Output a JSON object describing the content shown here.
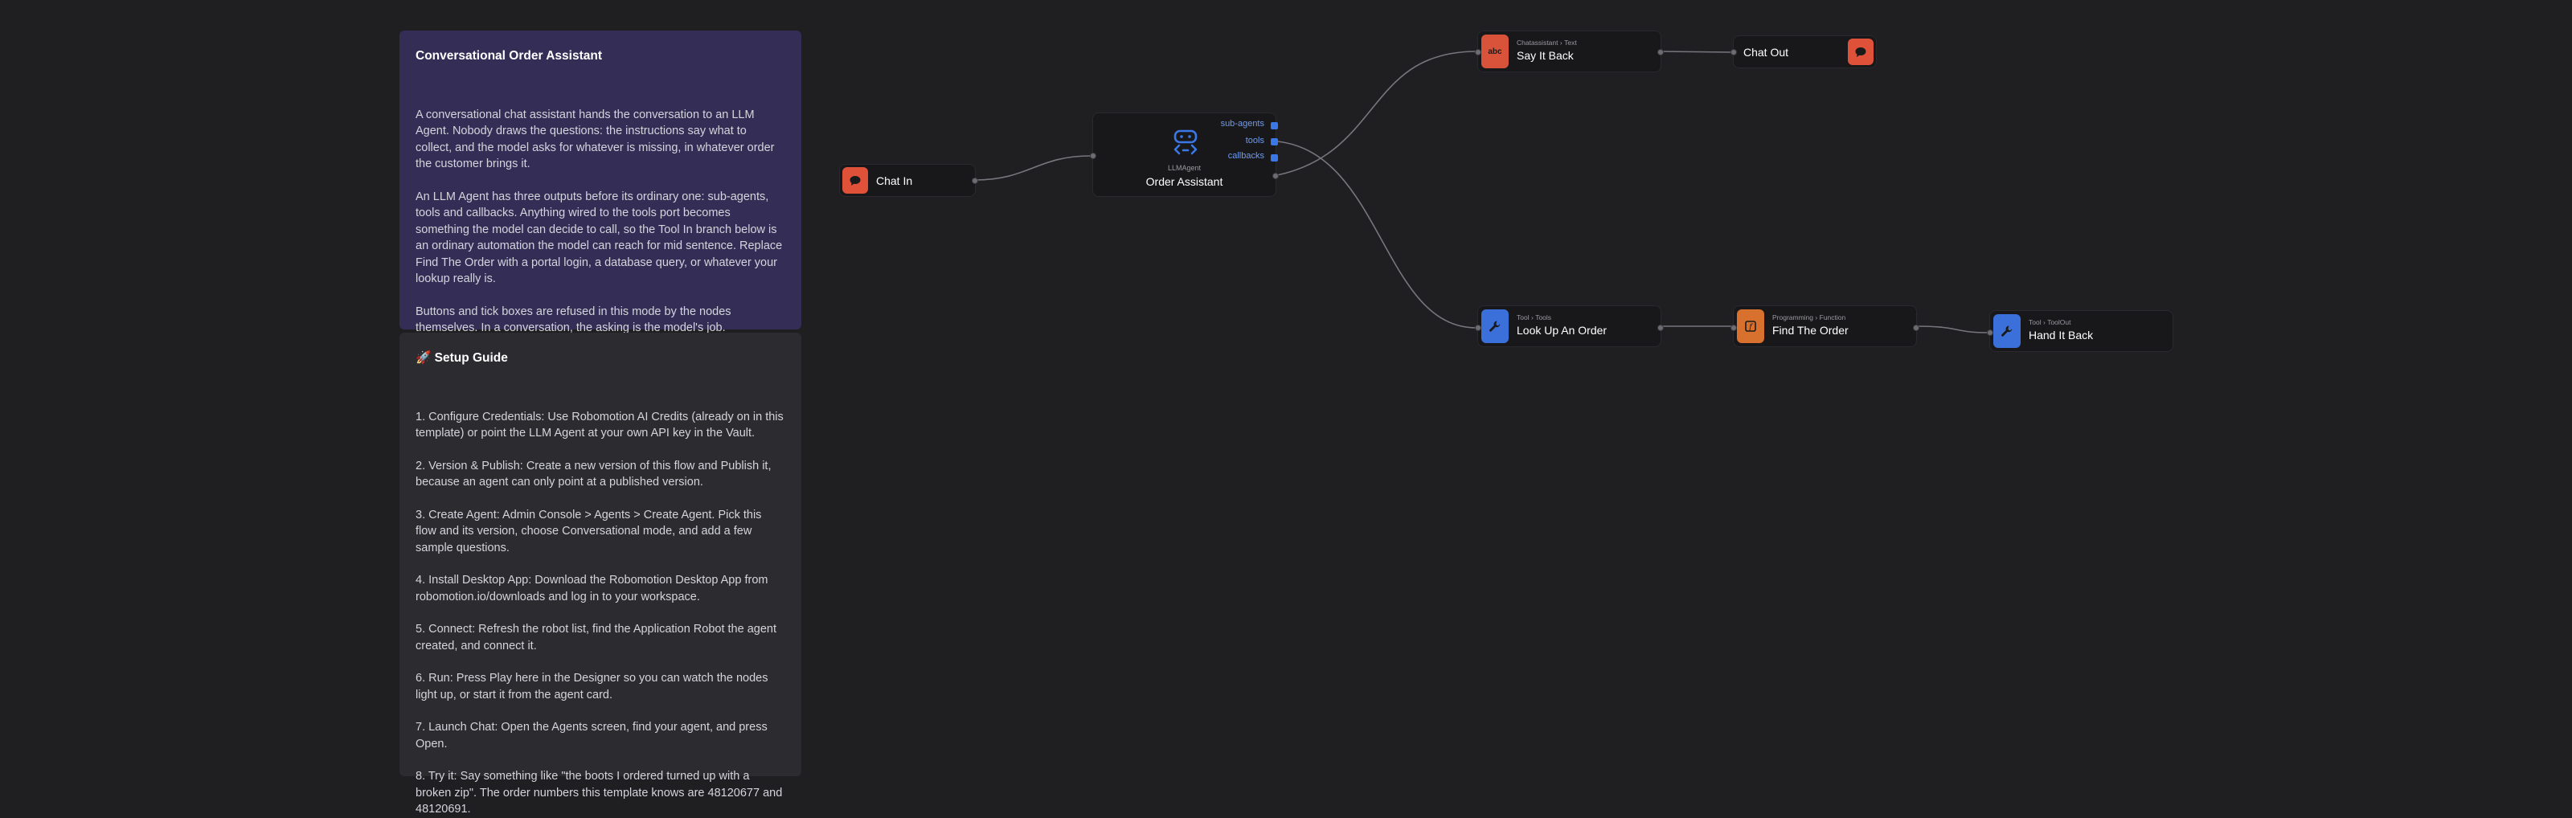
{
  "notes": {
    "intro": {
      "title": "Conversational Order Assistant",
      "paragraphs": [
        "A conversational chat assistant hands the conversation to an LLM Agent. Nobody draws the questions: the instructions say what to collect, and the model asks for whatever is missing, in whatever order the customer brings it.",
        "An LLM Agent has three outputs before its ordinary one: sub-agents, tools and callbacks. Anything wired to the tools port becomes something the model can decide to call, so the Tool In branch below is an ordinary automation the model can reach for mid sentence. Replace Find The Order with a portal login, a database query, or whatever your lookup really is.",
        "Buttons and tick boxes are refused in this mode by the nodes themselves. In a conversation, the asking is the model's job."
      ]
    },
    "guide": {
      "title": "🚀 Setup Guide",
      "steps": [
        "1. Configure Credentials: Use Robomotion AI Credits (already on in this template) or point the LLM Agent at your own API key in the Vault.",
        "2. Version & Publish: Create a new version of this flow and Publish it, because an agent can only point at a published version.",
        "3. Create Agent: Admin Console > Agents > Create Agent. Pick this flow and its version, choose Conversational mode, and add a few sample questions.",
        "4. Install Desktop App: Download the Robomotion Desktop App from robomotion.io/downloads and log in to your workspace.",
        "5. Connect: Refresh the robot list, find the Application Robot the agent created, and connect it.",
        "6. Run: Press Play here in the Designer so you can watch the nodes light up, or start it from the agent card.",
        "7. Launch Chat: Open the Agents screen, find your agent, and press Open.",
        "8. Try it: Say something like \"the boots I ordered turned up with a broken zip\". The order numbers this template knows are 48120677 and 48120691."
      ]
    }
  },
  "nodes": {
    "chat_in": {
      "title": "Chat In",
      "icon": "chat-bubble-icon",
      "color": "#e0513a"
    },
    "agent": {
      "category": "LLMAgent",
      "title": "Order Assistant",
      "icon": "robot-icon",
      "ports": [
        "sub-agents",
        "tools",
        "callbacks"
      ]
    },
    "say_it_back": {
      "category": "Chatassistant",
      "subcategory": "Text",
      "sep": "›",
      "title": "Say It Back",
      "icon": "text-abc-icon",
      "color": "#d9533b"
    },
    "chat_out": {
      "title": "Chat Out",
      "icon": "chat-bubble-icon",
      "color": "#e0513a"
    },
    "look_up": {
      "category": "Tool",
      "subcategory": "Tools",
      "sep": "›",
      "title": "Look Up An Order",
      "icon": "wrench-icon",
      "color": "#3b6fd9"
    },
    "find_order": {
      "category": "Programming",
      "subcategory": "Function",
      "sep": "›",
      "title": "Find The Order",
      "icon": "function-icon",
      "color": "#d9712e"
    },
    "hand_back": {
      "category": "Tool",
      "subcategory": "ToolOut",
      "sep": "›",
      "title": "Hand It Back",
      "icon": "wrench-icon",
      "color": "#3b6fd9"
    }
  },
  "colors": {
    "canvas": "#1f1f22",
    "intro_note": "#342e56",
    "guide_note": "#2c2b30",
    "wire": "#76767c",
    "agent_accent": "#3b78e7"
  }
}
